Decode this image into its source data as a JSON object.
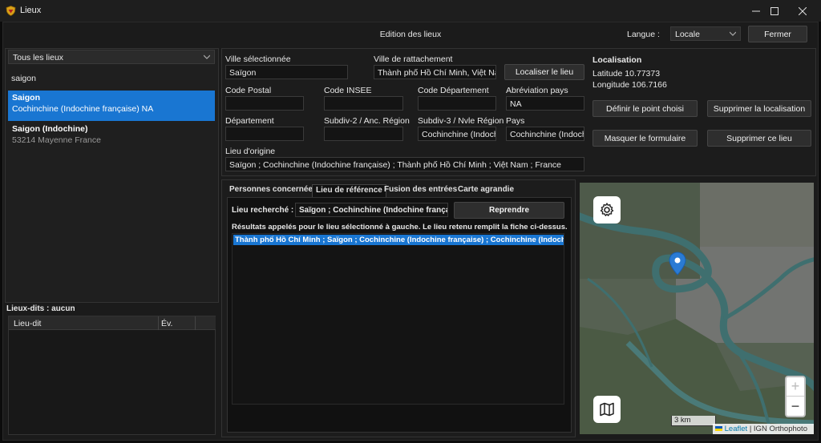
{
  "window": {
    "title": "Lieux"
  },
  "header": {
    "title": "Edition des lieux",
    "language_label": "Langue :",
    "language_value": "Locale",
    "close_label": "Fermer"
  },
  "sidebar": {
    "filter_value": "Tous les lieux",
    "search_value": "saigon",
    "results": [
      {
        "name": "Saigon",
        "detail": "Cochinchine (Indochine française) NA",
        "selected": true
      },
      {
        "name": "Saigon (Indochine)",
        "detail": "53214 Mayenne France",
        "selected": false
      }
    ],
    "lieux_dits_title": "Lieux-dits : aucun",
    "lieux_dits_columns": [
      "Lieu-dit",
      "Év."
    ]
  },
  "form": {
    "ville_selectionnee_label": "Ville sélectionnée",
    "ville_selectionnee_value": "Saïgon",
    "ville_rattachement_label": "Ville de rattachement",
    "ville_rattachement_value": "Thành phố Hồ Chí Minh, Việt Nam",
    "localiser_label": "Localiser le lieu",
    "code_postal_label": "Code Postal",
    "code_postal_value": "",
    "code_insee_label": "Code INSEE",
    "code_insee_value": "",
    "code_departement_label": "Code Département",
    "code_departement_value": "",
    "abreviation_pays_label": "Abréviation pays",
    "abreviation_pays_value": "NA",
    "departement_label": "Département",
    "departement_value": "",
    "subdiv2_label": "Subdiv-2 / Anc. Région",
    "subdiv2_value": "",
    "subdiv3_label": "Subdiv-3 / Nvle Région",
    "subdiv3_value": "Cochinchine (Indochine française)",
    "pays_label": "Pays",
    "pays_value": "Cochinchine (Indochine française)",
    "lieu_origine_label": "Lieu d'origine",
    "lieu_origine_value": "Saïgon ; Cochinchine (Indochine française) ; Thành phố Hồ Chí Minh ; Việt Nam ; France"
  },
  "localisation": {
    "title": "Localisation",
    "latitude": "Latitude 10.77373",
    "longitude": "Longitude 106.7166",
    "definir_label": "Définir le point choisi",
    "supprimer_loc_label": "Supprimer la localisation",
    "masquer_label": "Masquer le formulaire",
    "supprimer_lieu_label": "Supprimer ce lieu"
  },
  "tabs": [
    {
      "label": "Personnes concernées",
      "active": false
    },
    {
      "label": "Lieu de référence",
      "active": true
    },
    {
      "label": "Fusion des entrées",
      "active": false
    },
    {
      "label": "Carte agrandie",
      "active": false
    }
  ],
  "reference": {
    "search_label": "Lieu recherché :",
    "search_value": "Saïgon ; Cochinchine (Indochine française)",
    "reprendre_label": "Reprendre",
    "results_text": "Résultats appelés pour le lieu sélectionné à gauche. Le lieu retenu remplit la fiche ci-dessus.",
    "results": [
      "Thành phố Hồ Chí Minh ; Saïgon ; Cochinchine (Indochine française) ; Cochinchine (Indochine française)"
    ]
  },
  "map": {
    "scale": "3 km",
    "attribution_leaflet": "Leaflet",
    "attribution_separator": "|",
    "attribution_source": "IGN Orthophoto",
    "zoom_in": "+",
    "zoom_out": "−",
    "marker_color": "#2a7bd4"
  },
  "colors": {
    "selection": "#1976d2",
    "accent_blue": "#2a7bd4"
  }
}
